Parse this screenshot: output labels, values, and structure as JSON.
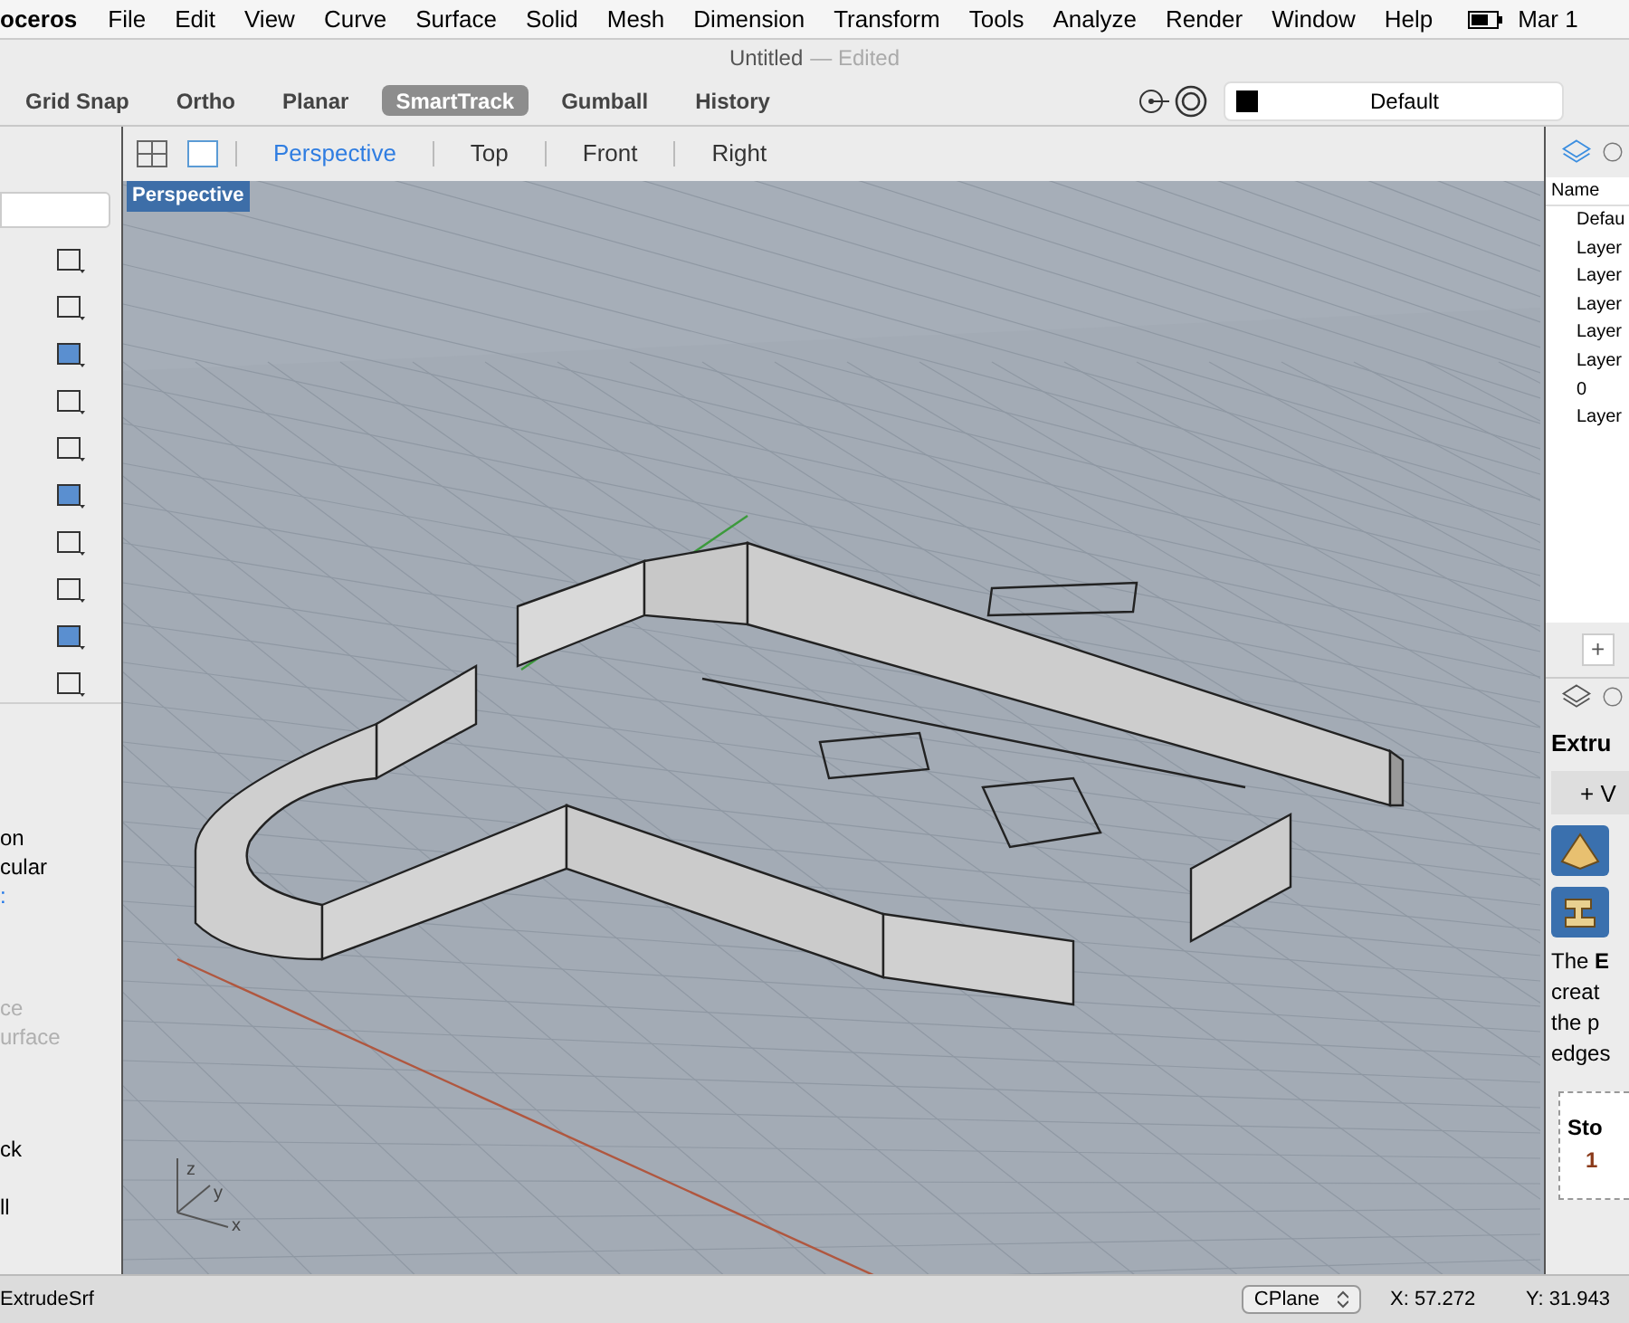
{
  "menu_bar": {
    "app": "oceros",
    "items": [
      "File",
      "Edit",
      "View",
      "Curve",
      "Surface",
      "Solid",
      "Mesh",
      "Dimension",
      "Transform",
      "Tools",
      "Analyze",
      "Render",
      "Window",
      "Help"
    ],
    "clock": "Mar 1"
  },
  "window": {
    "title": "Untitled",
    "subtitle": "— Edited"
  },
  "toggles": [
    {
      "label": "Grid Snap",
      "on": false
    },
    {
      "label": "Ortho",
      "on": false
    },
    {
      "label": "Planar",
      "on": false
    },
    {
      "label": "SmartTrack",
      "on": true
    },
    {
      "label": "Gumball",
      "on": false
    },
    {
      "label": "History",
      "on": false
    }
  ],
  "layer_field": {
    "value": "Default"
  },
  "view_tabs": [
    {
      "label": "Perspective",
      "selected": true
    },
    {
      "label": "Top",
      "selected": false
    },
    {
      "label": "Front",
      "selected": false
    },
    {
      "label": "Right",
      "selected": false
    }
  ],
  "viewport": {
    "label": "Perspective",
    "axes": [
      "z",
      "y",
      "x"
    ]
  },
  "left_panel": {
    "options": [
      {
        "text": "on",
        "kind": "normal"
      },
      {
        "text": "cular",
        "kind": "normal"
      },
      {
        "text": ":",
        "kind": "link"
      },
      {
        "text": "ce",
        "kind": "disabled"
      },
      {
        "text": "urface",
        "kind": "disabled"
      },
      {
        "text": "ck",
        "kind": "normal"
      },
      {
        "text": "ll",
        "kind": "normal"
      }
    ]
  },
  "layers_panel": {
    "header": "Name",
    "rows": [
      "Defau",
      "Layer",
      "Layer",
      "Layer",
      "Layer",
      "Layer",
      "0",
      "Layer"
    ],
    "add": "+"
  },
  "help_panel": {
    "title": "Extru",
    "button": "+ V",
    "paragraph": "The **E**\ncreat\nthe p\nedges",
    "steps_title": "Sto",
    "step": "1"
  },
  "status_bar": {
    "command": "ExtrudeSrf",
    "cplane": "CPlane",
    "x": "X: 57.272",
    "y": "Y: 31.943"
  }
}
